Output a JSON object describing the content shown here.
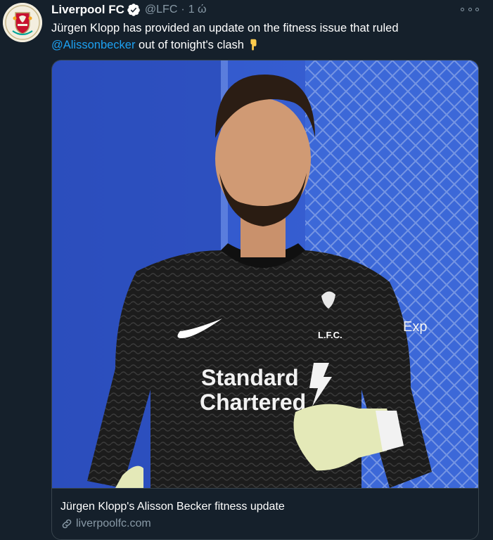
{
  "tweet": {
    "author_name": "Liverpool FC",
    "handle": "@LFC",
    "separator": "·",
    "time": "1 ώ",
    "text_before": "Jürgen Klopp has provided an update on the fitness issue that ruled ",
    "mention": "@Alissonbecker",
    "text_after": " out of tonight's clash"
  },
  "card": {
    "title": "Jürgen Klopp's Alisson Becker fitness update",
    "domain": "liverpoolfc.com",
    "jersey_sponsor_line1": "Standard",
    "jersey_sponsor_line2": "Chartered",
    "jersey_crest_text": "L.F.C.",
    "sleeve_text": "Exp"
  },
  "colors": {
    "background": "#15202b",
    "secondary_text": "#8899a6",
    "link": "#1da1f2",
    "border": "#38444d",
    "verified": "#ffffff"
  },
  "icons": [
    "lfc-crest-avatar",
    "verified-icon",
    "more-icon",
    "pointing-down-emoji",
    "link-icon"
  ]
}
